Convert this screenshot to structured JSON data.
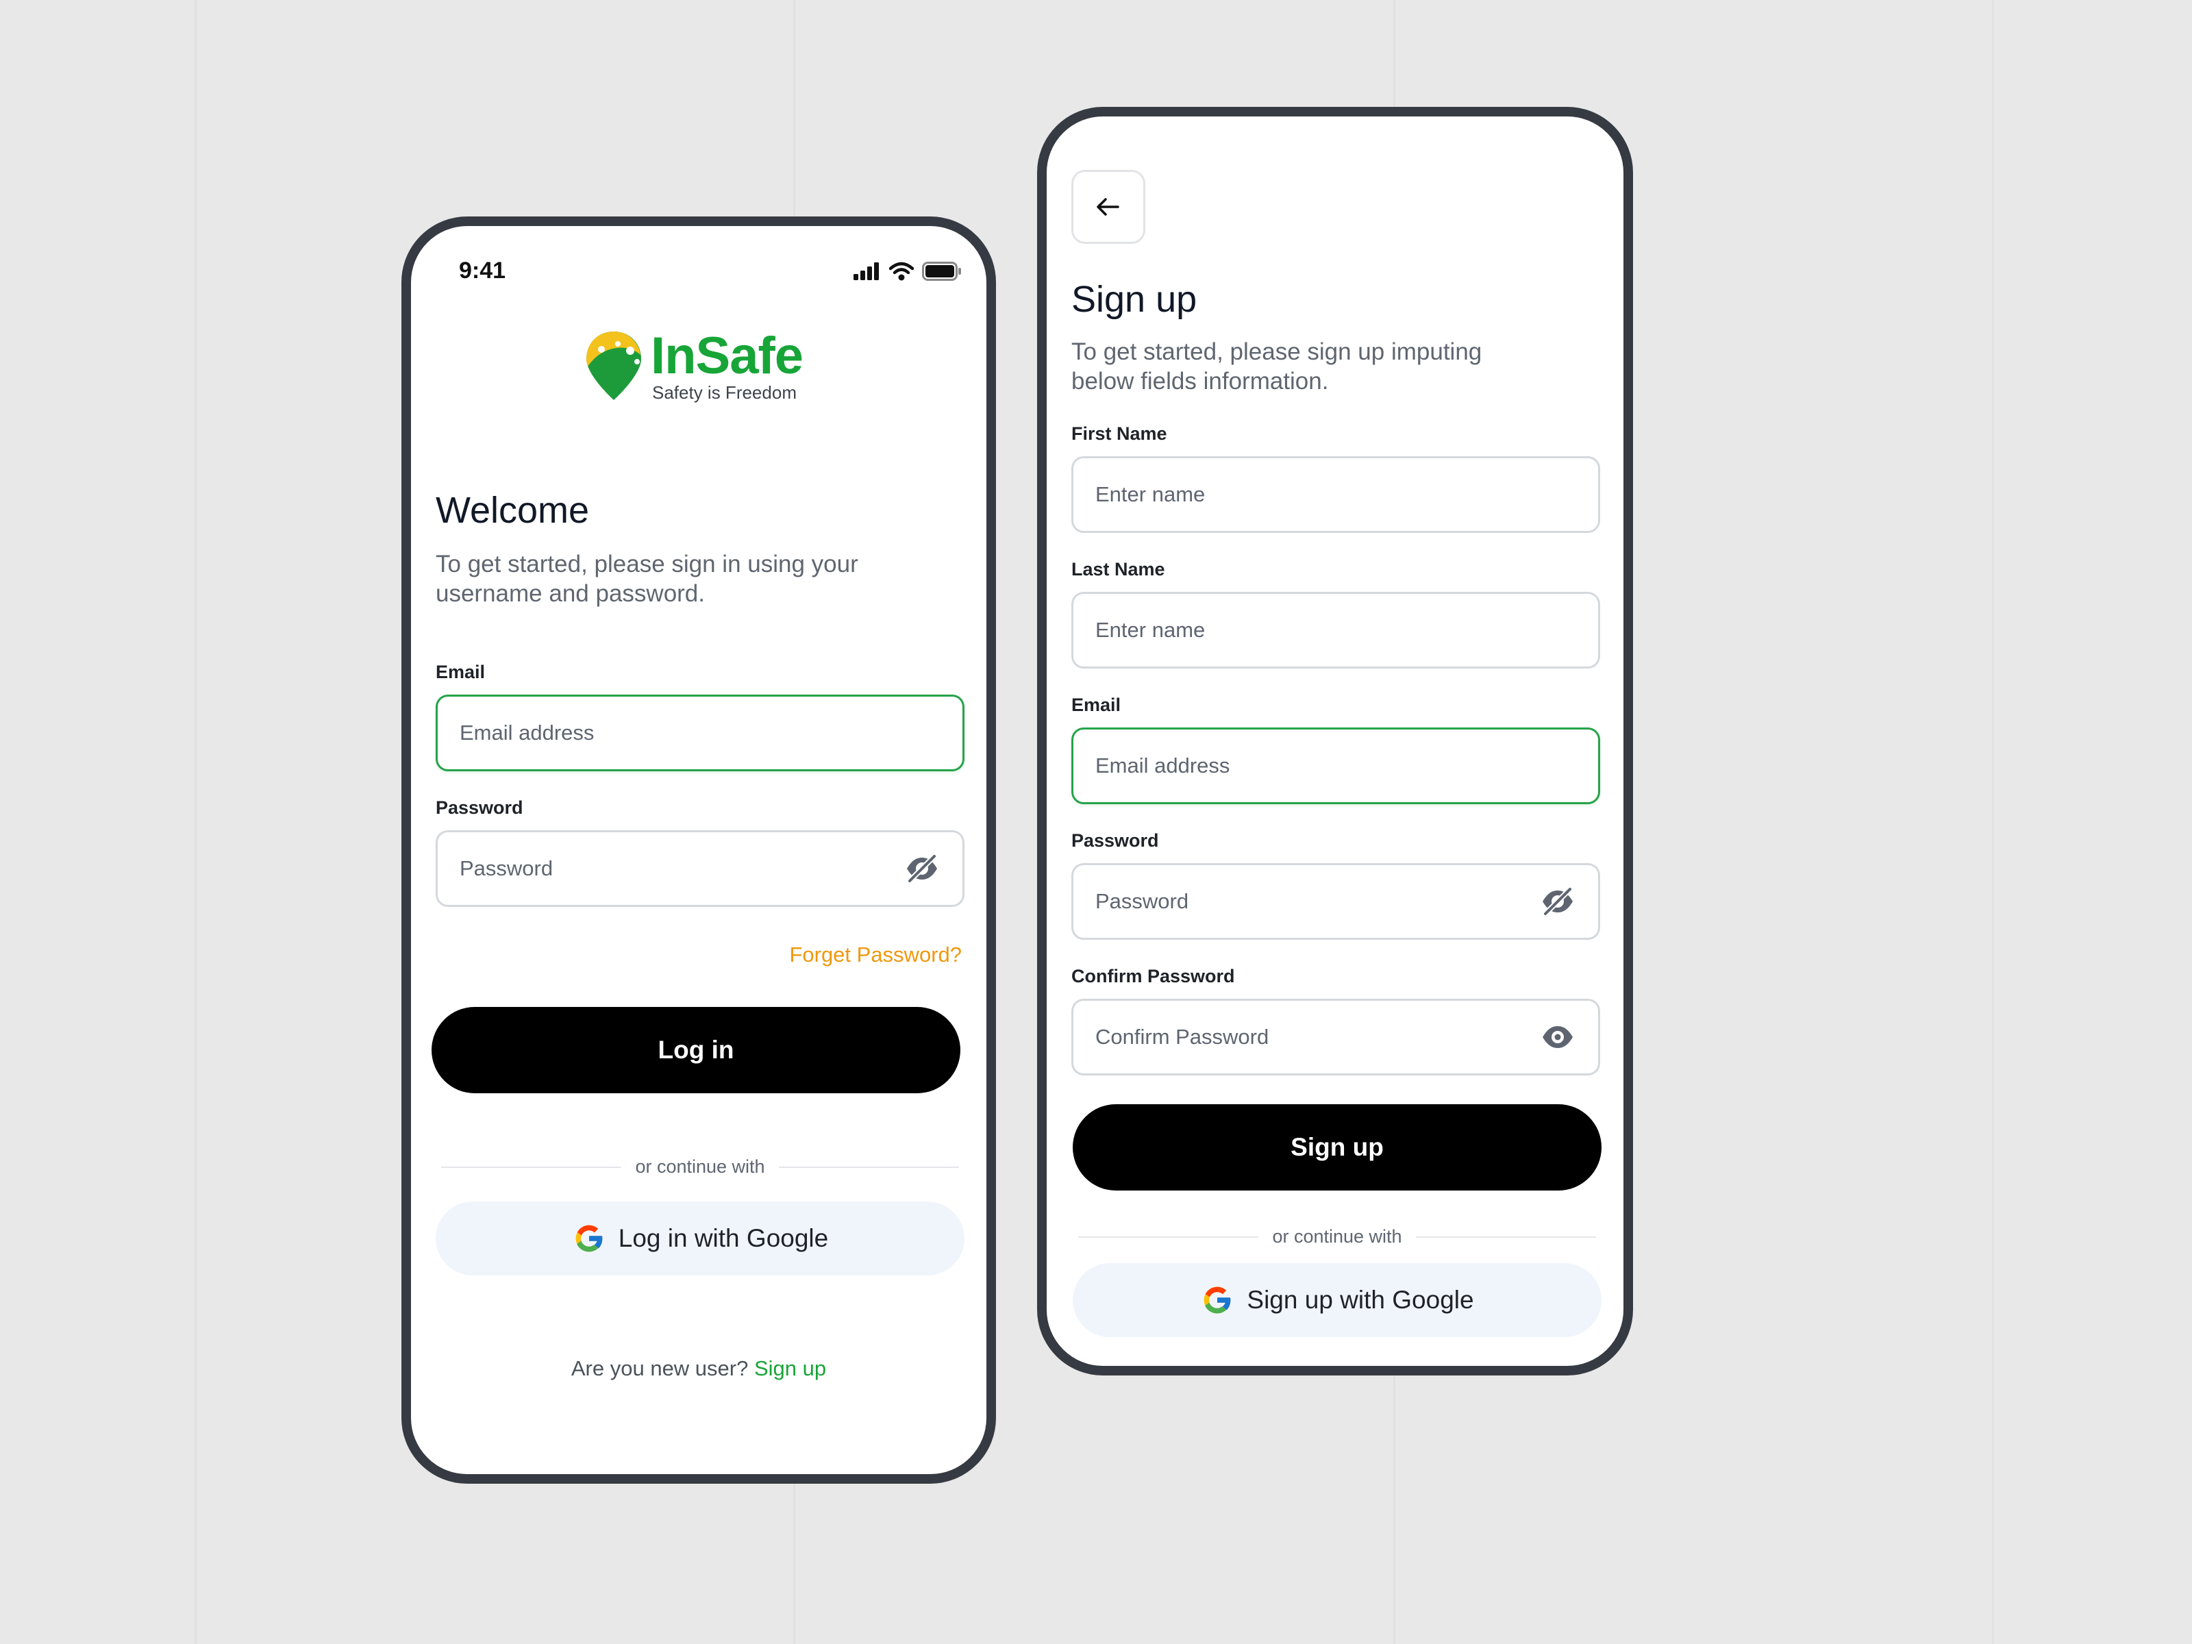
{
  "login": {
    "status_time": "9:41",
    "brand_name": "InSafe",
    "brand_tagline": "Safety is Freedom",
    "title": "Welcome",
    "subtitle_line1": "To get started, please sign in using your",
    "subtitle_line2": "username and password.",
    "email_label": "Email",
    "email_placeholder": "Email address",
    "password_label": "Password",
    "password_placeholder": "Password",
    "forgot_password": "Forget Password?",
    "login_button": "Log in",
    "divider_text": "or continue with",
    "google_button": "Log in with Google",
    "new_user_text": "Are you new user?",
    "signup_link": "Sign up"
  },
  "signup": {
    "title": "Sign up",
    "subtitle_line1": "To get started, please sign up imputing",
    "subtitle_line2": "below fields information.",
    "first_name_label": "First Name",
    "first_name_placeholder": "Enter name",
    "last_name_label": "Last Name",
    "last_name_placeholder": "Enter name",
    "email_label": "Email",
    "email_placeholder": "Email address",
    "password_label": "Password",
    "password_placeholder": "Password",
    "confirm_password_label": "Confirm Password",
    "confirm_password_placeholder": "Confirm Password",
    "signup_button": "Sign up",
    "divider_text": "or continue with",
    "google_button": "Sign up with Google"
  },
  "colors": {
    "accent_green": "#18a538",
    "focus_border": "#26a34a",
    "link_orange": "#f0980d",
    "phone_frame": "#363a42",
    "google_button_bg": "#f0f5fc",
    "primary_button_bg": "#000000"
  },
  "icons": {
    "signal": "signal-bars-icon",
    "wifi": "wifi-icon",
    "battery": "battery-icon",
    "logo": "location-pin-logo-icon",
    "eye_hidden": "eye-off-icon",
    "eye_visible": "eye-icon",
    "google": "google-g-icon",
    "back": "arrow-left-icon"
  }
}
